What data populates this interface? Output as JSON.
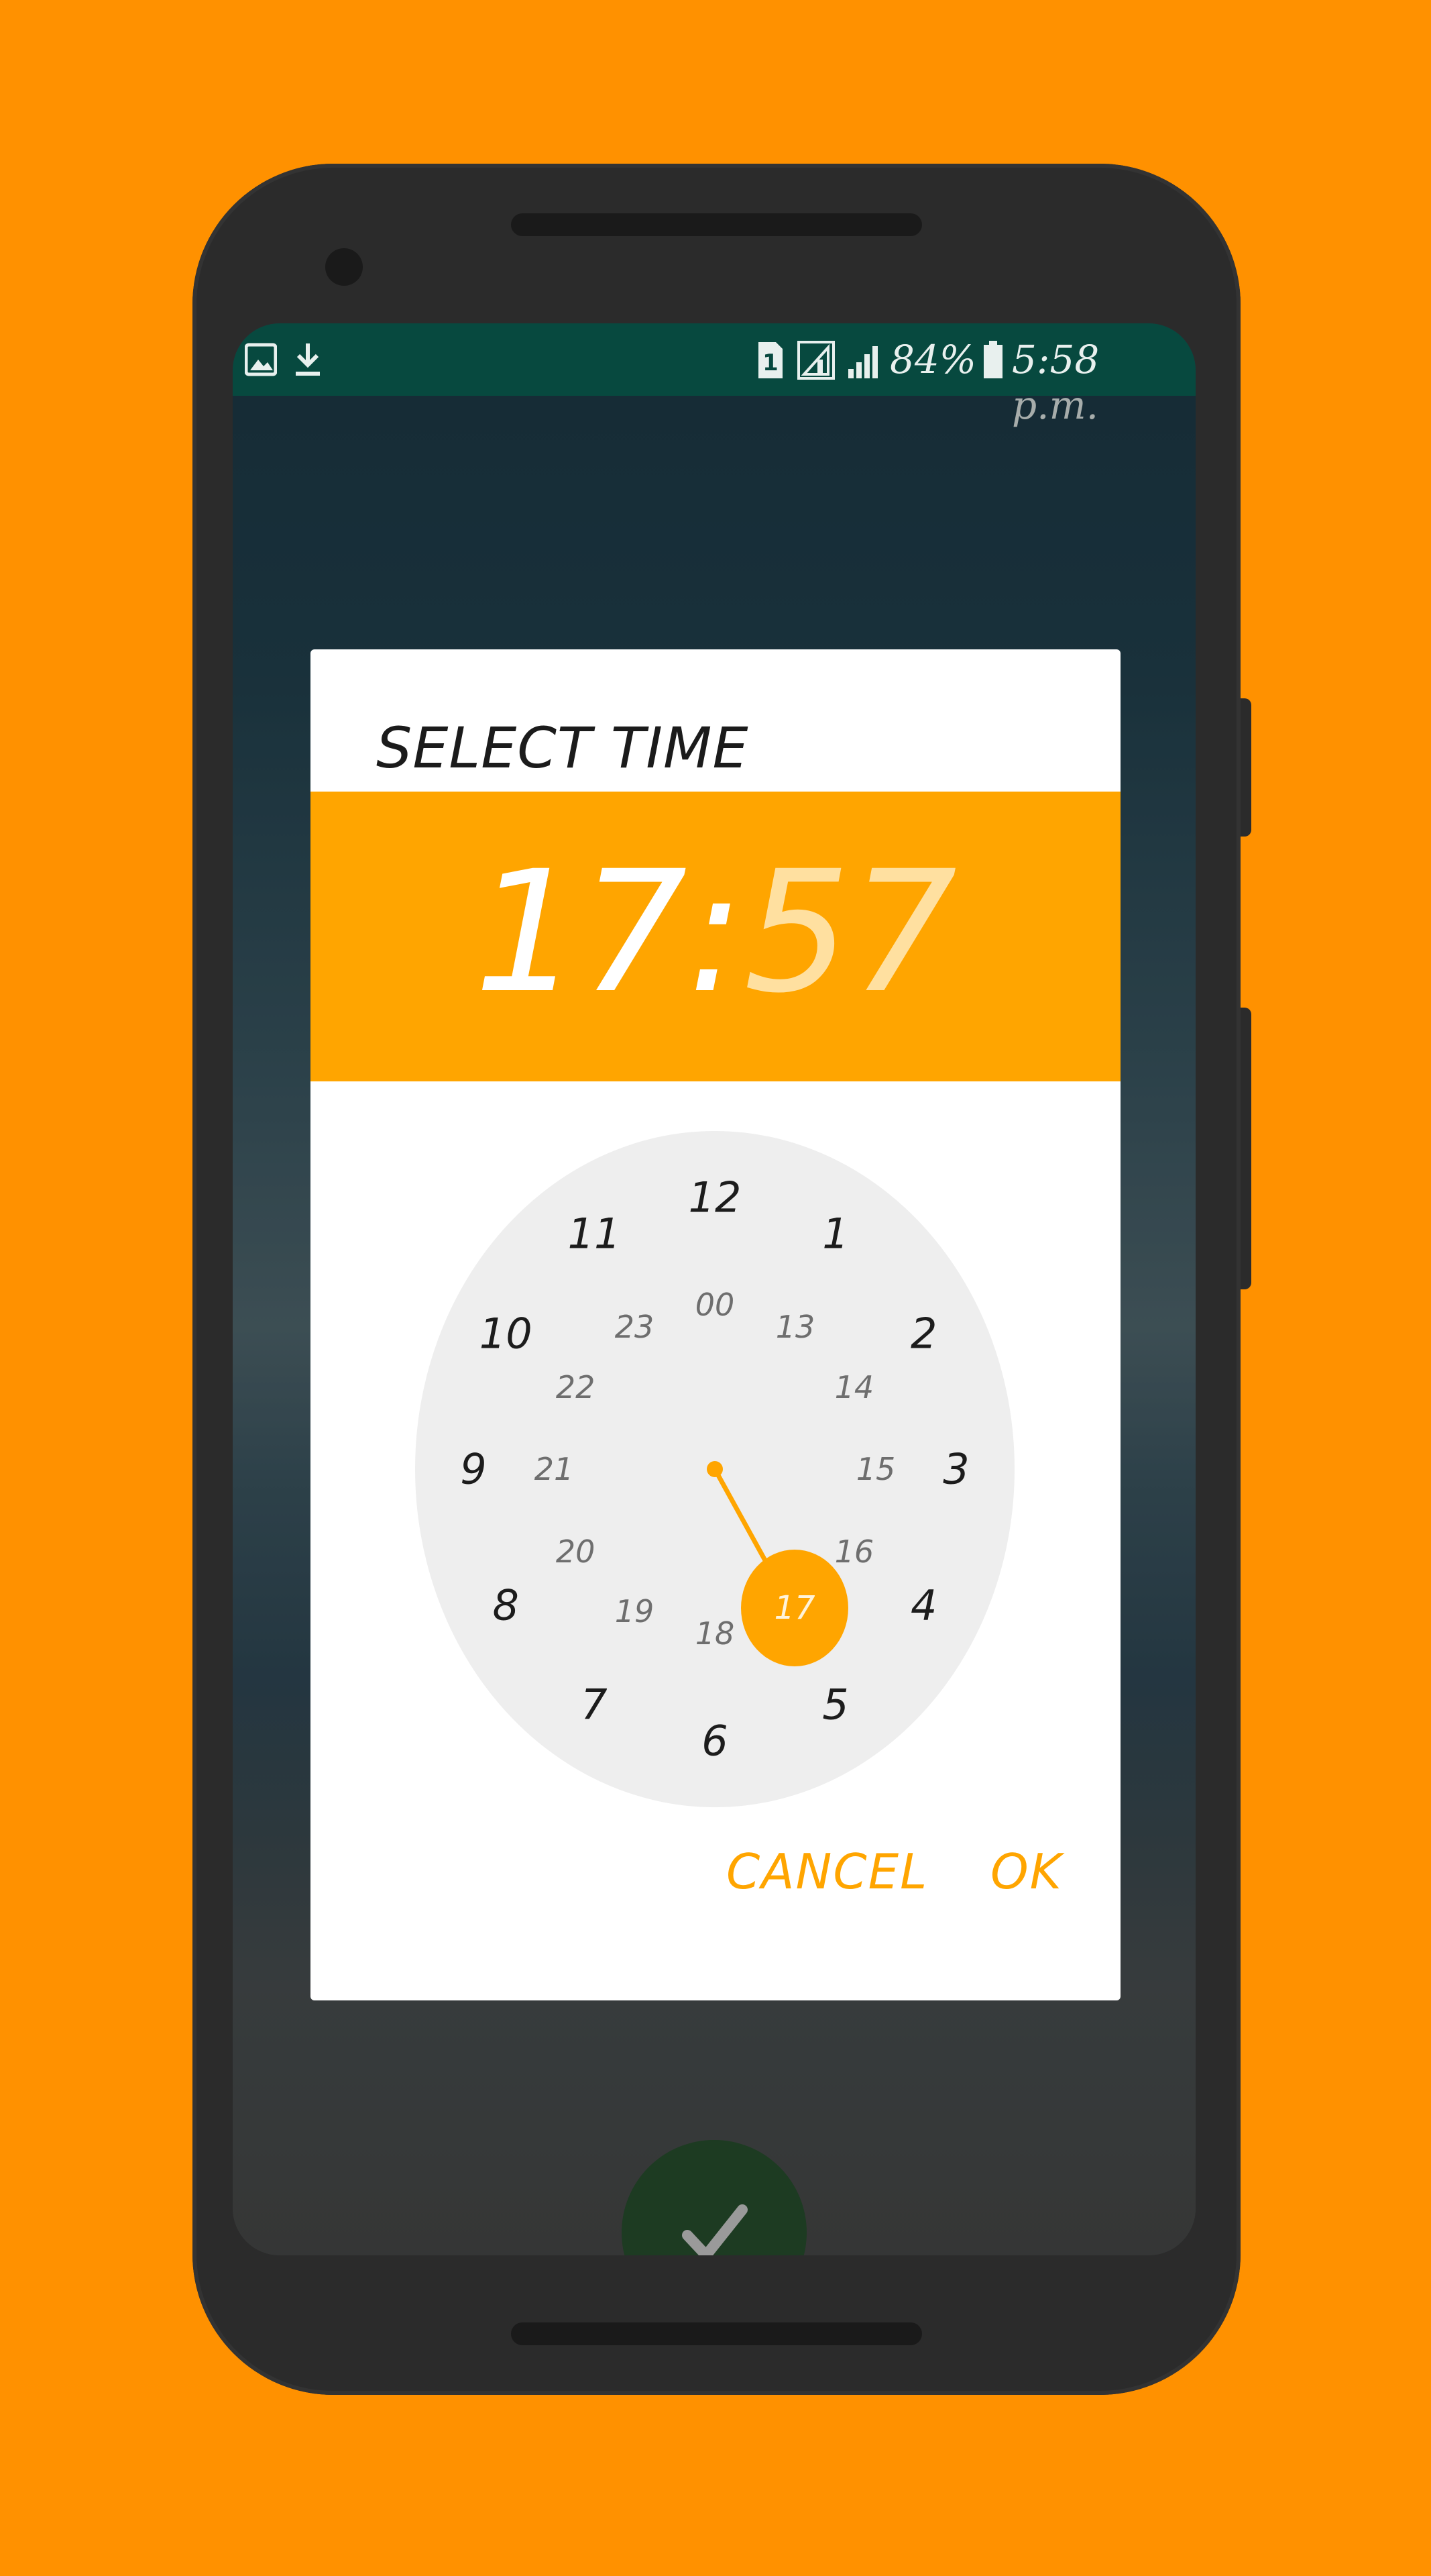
{
  "background_color": "#ff9100",
  "accent_color": "#ffa500",
  "status_bar": {
    "battery_percent": "84%",
    "clock": "5:58 p.m.",
    "sim_label": "1",
    "left_icons": [
      "gallery-notification-icon",
      "download-icon"
    ],
    "right_icons": [
      "sim-icon",
      "signal-icon",
      "signal-icon",
      "battery-icon"
    ]
  },
  "dialog": {
    "title": "SELECT TIME",
    "hour": "17",
    "separator": ":",
    "minute": "57",
    "selected_value": "17",
    "outer_numbers": [
      "12",
      "1",
      "2",
      "3",
      "4",
      "5",
      "6",
      "7",
      "8",
      "9",
      "10",
      "11"
    ],
    "inner_numbers": [
      "00",
      "13",
      "14",
      "15",
      "16",
      "17",
      "18",
      "19",
      "20",
      "21",
      "22",
      "23"
    ],
    "cancel_label": "CANCEL",
    "ok_label": "OK"
  },
  "fab": {
    "icon": "check-icon"
  }
}
